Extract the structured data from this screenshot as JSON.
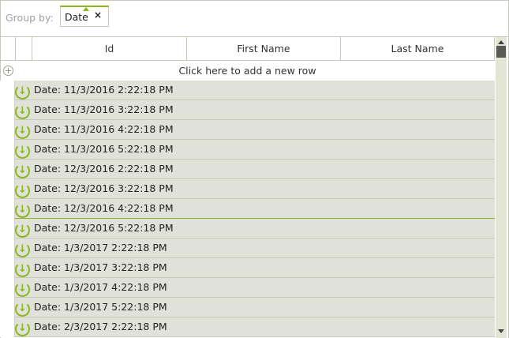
{
  "group_panel": {
    "label": "Group by:",
    "chip": "Date",
    "chip_close": "×"
  },
  "columns": [
    "Id",
    "First Name",
    "Last Name"
  ],
  "add_row": "Click here to add a new row",
  "groups": [
    "Date: 11/3/2016 2:22:18 PM",
    "Date: 11/3/2016 3:22:18 PM",
    "Date: 11/3/2016 4:22:18 PM",
    "Date: 11/3/2016 5:22:18 PM",
    "Date: 12/3/2016 2:22:18 PM",
    "Date: 12/3/2016 3:22:18 PM",
    "Date: 12/3/2016 4:22:18 PM",
    "Date: 12/3/2016 5:22:18 PM",
    "Date: 1/3/2017 2:22:18 PM",
    "Date: 1/3/2017 3:22:18 PM",
    "Date: 1/3/2017 4:22:18 PM",
    "Date: 1/3/2017 5:22:18 PM",
    "Date: 2/3/2017 2:22:18 PM"
  ],
  "selected_group_index": 6,
  "colors": {
    "accent": "#8cb522",
    "group_row": "#e0e2d9"
  }
}
